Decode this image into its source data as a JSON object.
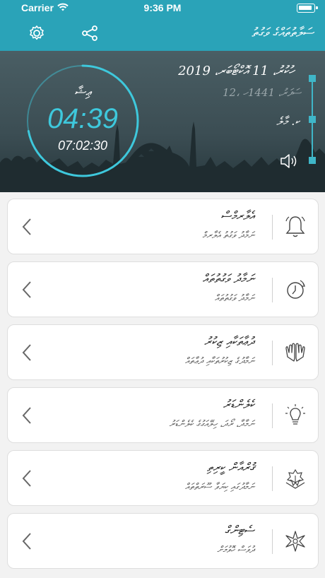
{
  "status_bar": {
    "carrier": "Carrier",
    "time": "9:36 PM"
  },
  "app_bar": {
    "title": "ސަލާތުތައްގެ ވަގުތު"
  },
  "hero": {
    "date_text": "ހުކުރު، 11 އޮކްޓޯބަރ، 2019",
    "hijri_text": "12، ސަފަރު، 1441ހ",
    "place_text": "ކ. މާލެ",
    "next_prayer_label": "ޢިޝާ",
    "next_prayer_time": "04:39",
    "countdown": "07:02:30",
    "ring_progress": 0.72
  },
  "menu": [
    {
      "title": "އެލާރމްސް",
      "subtitle": "ނަމާދު ވަގުތު އެލާރމް",
      "icon": "bell-icon"
    },
    {
      "title": "ނަމާދު ވަގުތުތައް",
      "subtitle": "ނަމާދު ވަގުތުތައް",
      "icon": "clock-icon"
    },
    {
      "title": "ދުޢާތަކާއި ޒިކުރު",
      "subtitle": "ނަމާދުގެ ޒިކުރުތަކާއި ދުޢާތައް",
      "icon": "praying-hands-icon"
    },
    {
      "title": "ކެލެންޑަރު",
      "subtitle": "ނަމާދާ، ރޯދަ، ހިލޭއަގުގެ ކެލެންޑަރު",
      "icon": "lightbulb-icon"
    },
    {
      "title": "ޤުރްއާން ކީރިތި",
      "subtitle": "ނަމާދުގައި ކިޔަވާ ސޫރަތްތައް",
      "icon": "quran-icon"
    },
    {
      "title": "ސެޓިންގް",
      "subtitle": "ދުވަސް ހޮވުމަށް",
      "icon": "compass-star-icon"
    }
  ],
  "colors": {
    "accent": "#2aa3b8",
    "ring": "#3ec8dc"
  }
}
